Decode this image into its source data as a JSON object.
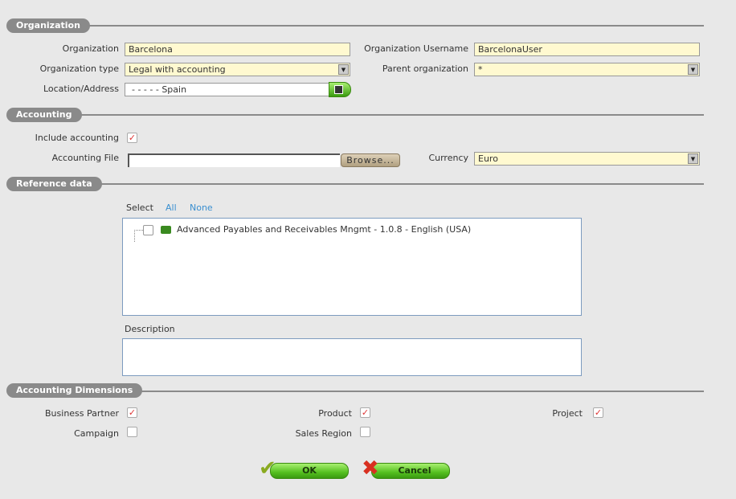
{
  "sections": {
    "organization": "Organization",
    "accounting": "Accounting",
    "reference": "Reference data",
    "dimensions": "Accounting Dimensions"
  },
  "org": {
    "org_label": "Organization",
    "org_value": "Barcelona",
    "username_label": "Organization Username",
    "username_value": "BarcelonaUser",
    "type_label": "Organization type",
    "type_value": "Legal with accounting",
    "parent_label": "Parent organization",
    "parent_value": "*",
    "location_label": "Location/Address",
    "location_value": "- - - - - Spain"
  },
  "accounting": {
    "include_label": "Include accounting",
    "include_checked": true,
    "file_label": "Accounting File",
    "file_value": "",
    "browse": "Browse...",
    "currency_label": "Currency",
    "currency_value": "Euro"
  },
  "reference": {
    "select": "Select",
    "all": "All",
    "none": "None",
    "modules": [
      {
        "label": "Advanced Payables and Receivables Mngmt - 1.0.8 - English (USA)",
        "checked": false
      }
    ],
    "description_label": "Description",
    "description_value": ""
  },
  "dimensions": [
    {
      "label": "Business Partner",
      "checked": true
    },
    {
      "label": "Product",
      "checked": true
    },
    {
      "label": "Project",
      "checked": true
    },
    {
      "label": "Campaign",
      "checked": false
    },
    {
      "label": "Sales Region",
      "checked": false
    }
  ],
  "buttons": {
    "ok": "OK",
    "cancel": "Cancel"
  }
}
